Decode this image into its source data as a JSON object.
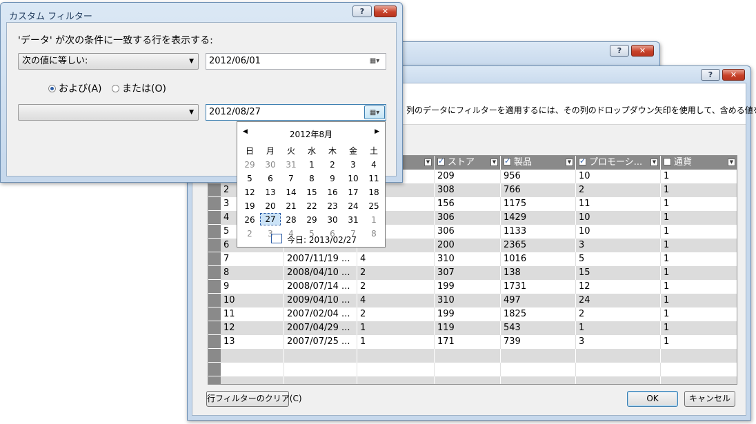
{
  "filter_dialog": {
    "title": "カスタム フィルター",
    "prompt": "'データ' が次の条件に一致する行を表示する:",
    "condition1": {
      "operator": "次の値に等しい:",
      "value": "2012/06/01"
    },
    "and_label": "および(A)",
    "or_label": "または(O)",
    "condition2": {
      "operator": "",
      "value": "2012/08/27"
    }
  },
  "calendar": {
    "month_label": "2012年8月",
    "weekdays": [
      "日",
      "月",
      "火",
      "水",
      "木",
      "金",
      "土"
    ],
    "weeks": [
      [
        "29",
        "30",
        "31",
        "1",
        "2",
        "3",
        "4"
      ],
      [
        "5",
        "6",
        "7",
        "8",
        "9",
        "10",
        "11"
      ],
      [
        "12",
        "13",
        "14",
        "15",
        "16",
        "17",
        "18"
      ],
      [
        "19",
        "20",
        "21",
        "22",
        "23",
        "24",
        "25"
      ],
      [
        "26",
        "27",
        "28",
        "29",
        "30",
        "31",
        "1"
      ],
      [
        "2",
        "3",
        "4",
        "5",
        "6",
        "7",
        "8"
      ]
    ],
    "selected_day": "27",
    "today_label": "今日: 2013/02/27"
  },
  "main_dialog": {
    "instruction": "列のデータにフィルターを適用するには、その列のドロップダウン矢印を使用して、含める値を",
    "grid": {
      "headers": [
        {
          "label": "",
          "checked": null
        },
        {
          "label": "",
          "checked": null
        },
        {
          "label": "ル",
          "checked": null
        },
        {
          "label": "ストア",
          "checked": true
        },
        {
          "label": "製品",
          "checked": true
        },
        {
          "label": "プロモーシ...",
          "checked": true
        },
        {
          "label": "通貨",
          "checked": false
        }
      ],
      "rows": [
        [
          "1",
          "",
          "",
          "209",
          "956",
          "10",
          "1"
        ],
        [
          "2",
          "",
          "",
          "308",
          "766",
          "2",
          "1"
        ],
        [
          "3",
          "",
          "",
          "156",
          "1175",
          "11",
          "1"
        ],
        [
          "4",
          "",
          "",
          "306",
          "1429",
          "10",
          "1"
        ],
        [
          "5",
          "",
          "",
          "306",
          "1133",
          "10",
          "1"
        ],
        [
          "6",
          "",
          "",
          "200",
          "2365",
          "3",
          "1"
        ],
        [
          "7",
          "2007/11/19 ...",
          "4",
          "310",
          "1016",
          "5",
          "1"
        ],
        [
          "8",
          "2008/04/10 ...",
          "2",
          "307",
          "138",
          "15",
          "1"
        ],
        [
          "9",
          "2008/07/14 ...",
          "2",
          "199",
          "1731",
          "12",
          "1"
        ],
        [
          "10",
          "2009/04/10 ...",
          "4",
          "310",
          "497",
          "24",
          "1"
        ],
        [
          "11",
          "2007/02/04 ...",
          "2",
          "199",
          "1825",
          "2",
          "1"
        ],
        [
          "12",
          "2007/04/29 ...",
          "1",
          "119",
          "543",
          "1",
          "1"
        ],
        [
          "13",
          "2007/07/25 ...",
          "1",
          "171",
          "739",
          "3",
          "1"
        ]
      ]
    },
    "clear_button": "行フィルターのクリア(C)",
    "ok_button": "OK",
    "cancel_button": "キャンセル"
  },
  "title_buttons": {
    "help": "?",
    "close": "✕"
  }
}
